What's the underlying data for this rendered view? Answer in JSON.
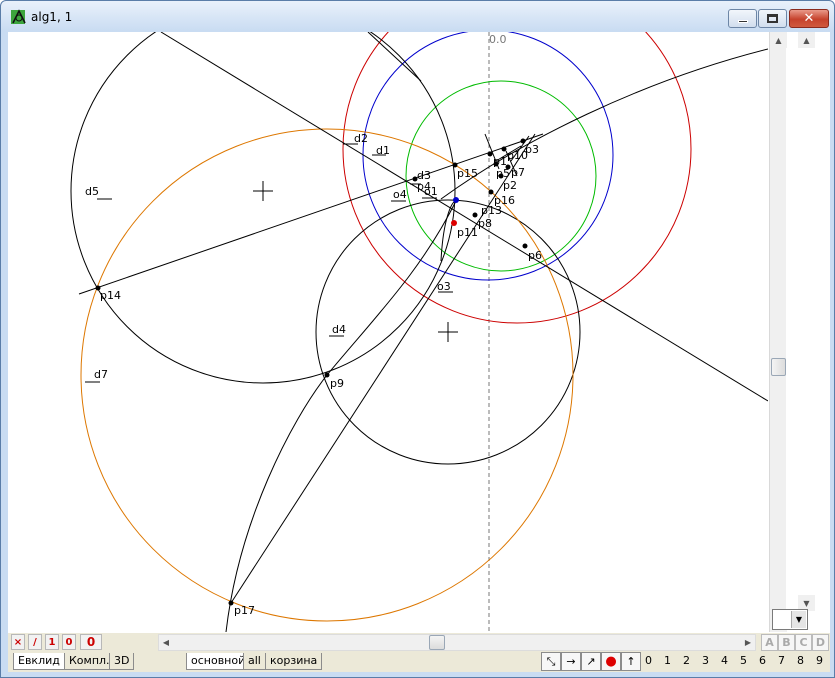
{
  "window": {
    "title": "alg1, 1"
  },
  "canvas": {
    "axis_label": "0.0",
    "labels": {
      "d1": "d1",
      "d2": "d2",
      "d3": "d3",
      "d4": "d4",
      "d5": "d5",
      "d7": "d7",
      "o1": "o1",
      "o3": "o3",
      "o4": "o4",
      "p1": "p1",
      "p2": "p2",
      "p3": "p3",
      "p5": "p5",
      "p6": "p6",
      "p7": "p7",
      "p8": "p8",
      "p9": "p9",
      "p10": "p10",
      "p11": "p11",
      "p13": "p13",
      "p14": "p14",
      "p15": "p15",
      "p16": "p16",
      "p17": "p17",
      "p4": "p4"
    },
    "colors": {
      "red": "#cc0000",
      "blue": "#0000cc",
      "green": "#00bb00",
      "orange": "#dd7700",
      "black": "#000000"
    }
  },
  "bottom": {
    "buttons": {
      "x": "×",
      "slash": "/",
      "one": "1",
      "zero": "0",
      "big_zero": "0"
    },
    "abcd": [
      "A",
      "B",
      "C",
      "D"
    ],
    "tabs": [
      "Евклид",
      "Компл.",
      "3D",
      "основной",
      "all",
      "корзина"
    ],
    "digits": [
      "0",
      "1",
      "2",
      "3",
      "4",
      "5",
      "6",
      "7",
      "8",
      "9"
    ]
  }
}
